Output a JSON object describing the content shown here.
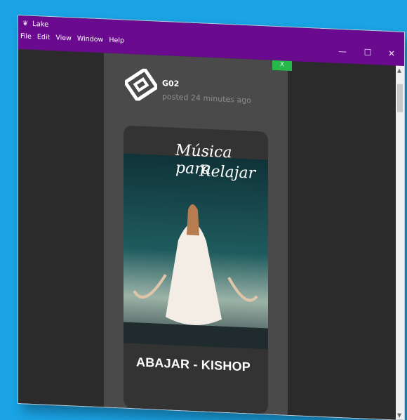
{
  "window": {
    "title": "Lake",
    "app_icon": "leaf-icon",
    "controls": {
      "minimize": "—",
      "maximize": "☐",
      "close": "✕"
    },
    "menu": [
      "File",
      "Edit",
      "View",
      "Window",
      "Help"
    ],
    "accent_color": "#6a0a8f",
    "background_color": "#1aa4e6"
  },
  "post": {
    "green_tab": "X",
    "author": "G02",
    "posted": "posted 24 minutes ago",
    "avatar_icon": "kishop-logo-icon",
    "cover_title_line1": "Música para",
    "cover_title_line2": "Relajar",
    "song_title": "ABAJAR - KISHOP"
  },
  "scroll": {
    "up": "▲",
    "down": "▼"
  }
}
